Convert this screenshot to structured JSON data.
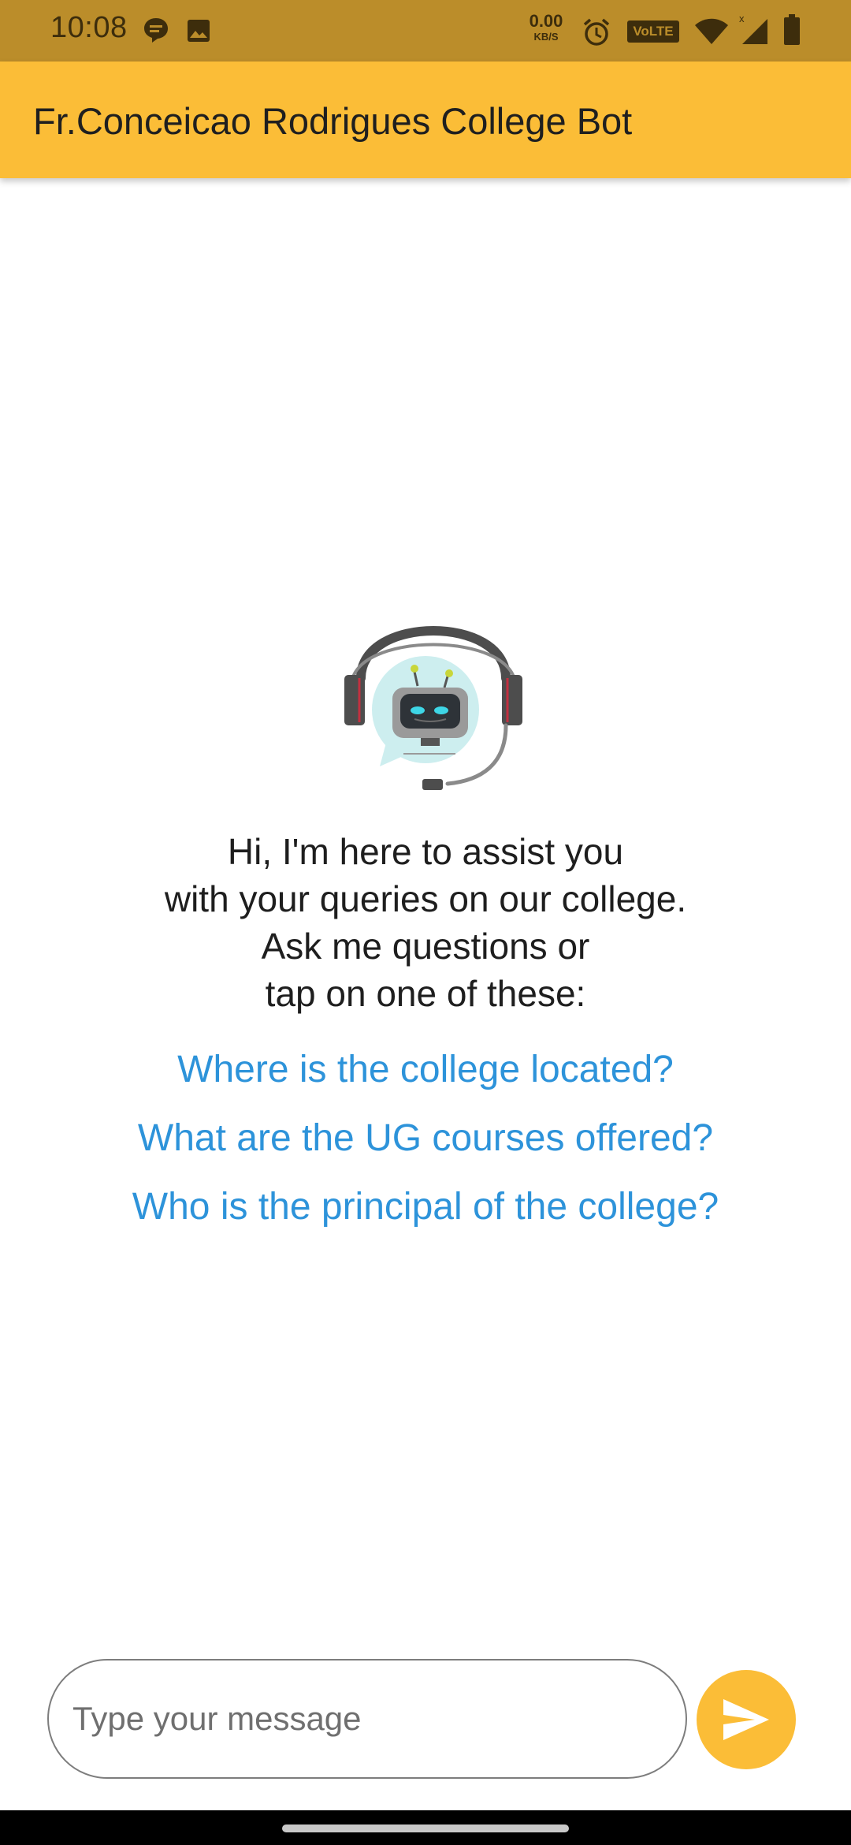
{
  "status_bar": {
    "time": "10:08",
    "net_speed_value": "0.00",
    "net_speed_unit": "KB/S",
    "volte_label": "VoLTE",
    "icons": [
      "chat-bubble-icon",
      "image-icon",
      "alarm-icon",
      "volte-icon",
      "wifi-icon",
      "cell-signal-icon",
      "battery-icon"
    ]
  },
  "app_bar": {
    "title": "Fr.Conceicao Rodrigues College Bot",
    "color": "#FBBD37"
  },
  "welcome": {
    "illustration": "support-bot-icon",
    "lines": [
      "Hi, I'm here to assist you",
      "with your queries on our college.",
      "Ask me questions or",
      "tap on one of these:"
    ],
    "suggestions": [
      "Where is the college located?",
      "What are the UG courses offered?",
      "Who is the principal of the college?"
    ],
    "suggestion_color": "#2D93DA"
  },
  "composer": {
    "placeholder": "Type your message",
    "value": "",
    "send_icon": "send-icon"
  }
}
